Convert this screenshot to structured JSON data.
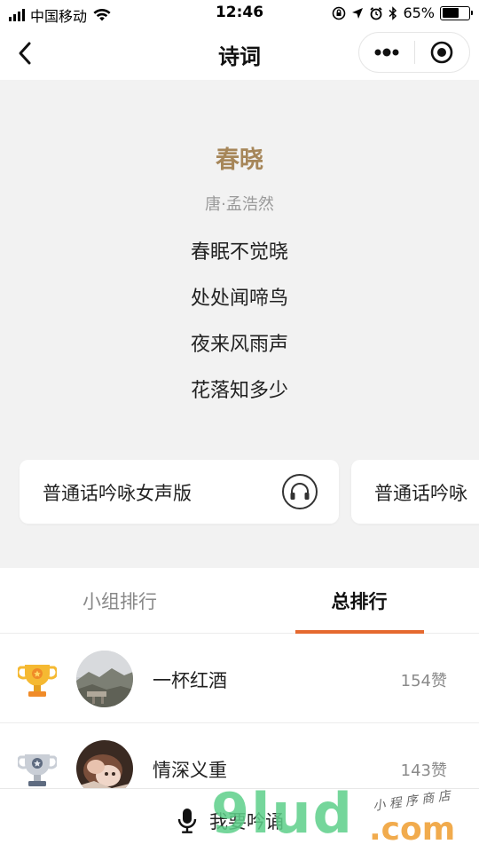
{
  "status_bar": {
    "carrier": "中国移动",
    "time": "12:46",
    "battery": "65%",
    "battery_level": 0.65
  },
  "nav": {
    "title": "诗词",
    "back_icon": "chevron-left-icon",
    "more_icon": "more-dots-icon",
    "close_icon": "record-target-icon"
  },
  "poem": {
    "title": "春晓",
    "author": "唐·孟浩然",
    "lines": [
      "春眠不觉晓",
      "处处闻啼鸟",
      "夜来风雨声",
      "花落知多少"
    ]
  },
  "versions": [
    {
      "label": "普通话吟咏女声版",
      "icon": "headphones-icon"
    },
    {
      "label": "普通话吟咏",
      "icon": "headphones-icon"
    }
  ],
  "tabs": [
    {
      "label": "小组排行",
      "active": false
    },
    {
      "label": "总排行",
      "active": true
    }
  ],
  "accent_color": "#e5692f",
  "title_color": "#a68659",
  "ranking": [
    {
      "name": "一杯红酒",
      "likes": "154赞",
      "trophy": "gold-trophy-icon"
    },
    {
      "name": "情深义重",
      "likes": "143赞",
      "trophy": "silver-trophy-icon"
    }
  ],
  "bottom": {
    "recite_label": "我要吟诵",
    "icon": "microphone-icon"
  },
  "watermark": {
    "main": "9lud",
    "domain": ".com",
    "tagline": "小 程 序 商 店"
  }
}
